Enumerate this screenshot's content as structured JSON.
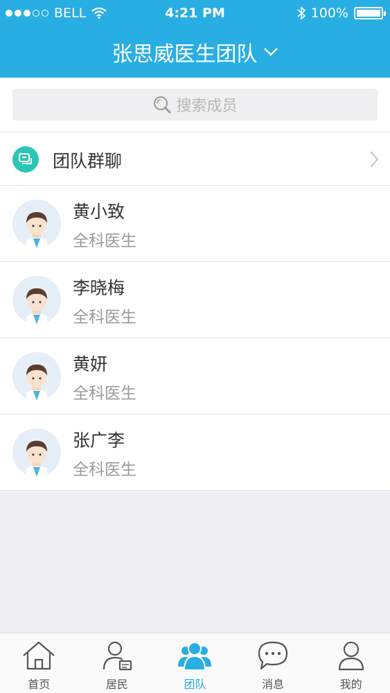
{
  "status": {
    "carrier": "BELL",
    "time": "4:21 PM",
    "battery": "100%"
  },
  "header": {
    "title": "张思威医生团队"
  },
  "search": {
    "placeholder": "搜索成员"
  },
  "group_chat": {
    "label": "团队群聊"
  },
  "members": [
    {
      "name": "黄小致",
      "role": "全科医生"
    },
    {
      "name": "李晓梅",
      "role": "全科医生"
    },
    {
      "name": "黄妍",
      "role": "全科医生"
    },
    {
      "name": "张广李",
      "role": "全科医生"
    }
  ],
  "tabs": [
    {
      "label": "首页",
      "icon": "home-icon"
    },
    {
      "label": "居民",
      "icon": "resident-icon"
    },
    {
      "label": "团队",
      "icon": "team-icon"
    },
    {
      "label": "消息",
      "icon": "message-icon"
    },
    {
      "label": "我的",
      "icon": "profile-icon"
    }
  ],
  "colors": {
    "accent": "#29aee3",
    "group_icon": "#2bc7b4"
  }
}
